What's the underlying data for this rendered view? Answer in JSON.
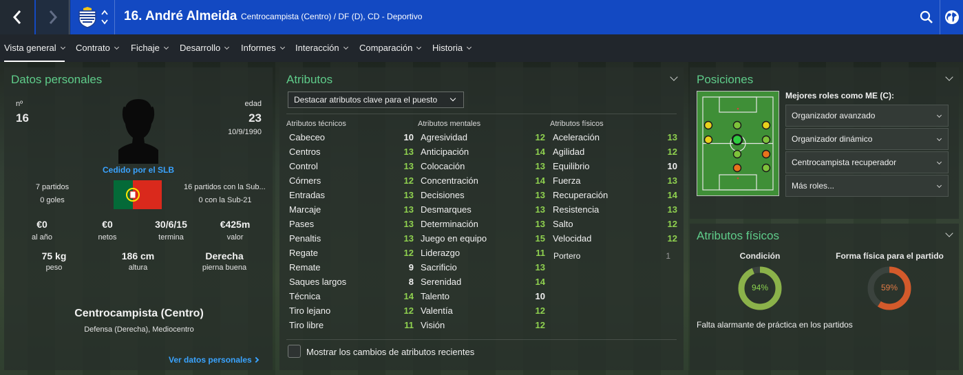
{
  "header": {
    "title": "16. André Almeida",
    "subtitle": "Centrocampista (Centro) / DF (D), CD - Deportivo",
    "back_icon": "chevron-left-icon",
    "forward_icon": "chevron-right-icon",
    "club_crest": "deportivo-crest-icon",
    "search_icon": "search-icon",
    "globe_icon": "globe-icon"
  },
  "menu": [
    {
      "label": "Vista general",
      "active": true
    },
    {
      "label": "Contrato"
    },
    {
      "label": "Fichaje"
    },
    {
      "label": "Desarrollo"
    },
    {
      "label": "Informes"
    },
    {
      "label": "Interacción"
    },
    {
      "label": "Comparación"
    },
    {
      "label": "Historia"
    }
  ],
  "personal": {
    "title": "Datos personales",
    "number_label": "nº",
    "number": "16",
    "age_label": "edad",
    "age": "23",
    "birthdate": "10/9/1990",
    "loan_text": "Cedido por el SLB",
    "apps": "7 partidos",
    "goals": "0 goles",
    "u21_apps": "16 partidos con la Sub...",
    "u21_goals": "0 con la Sub-21",
    "wage": "€0",
    "wage_label": "al año",
    "net": "€0",
    "net_label": "netos",
    "contract_end": "30/6/15",
    "contract_label": "termina",
    "value": "€425m",
    "value_label": "valor",
    "weight": "75 kg",
    "weight_label": "peso",
    "height": "186 cm",
    "height_label": "altura",
    "foot": "Derecha",
    "foot_label": "pierna buena",
    "position": "Centrocampista (Centro)",
    "position_sub": "Defensa (Derecha), Mediocentro",
    "link": "Ver datos personales",
    "flag": "portugal-flag-icon"
  },
  "attributes": {
    "title": "Atributos",
    "highlight_dropdown": "Destacar atributos clave para el puesto",
    "technical_header": "Atributos técnicos",
    "mental_header": "Atributos mentales",
    "physical_header": "Atributos físicos",
    "technical": [
      {
        "name": "Cabeceo",
        "value": "10"
      },
      {
        "name": "Centros",
        "value": "13"
      },
      {
        "name": "Control",
        "value": "13"
      },
      {
        "name": "Córners",
        "value": "12"
      },
      {
        "name": "Entradas",
        "value": "13"
      },
      {
        "name": "Marcaje",
        "value": "13"
      },
      {
        "name": "Pases",
        "value": "13"
      },
      {
        "name": "Penaltis",
        "value": "13"
      },
      {
        "name": "Regate",
        "value": "12"
      },
      {
        "name": "Remate",
        "value": "9"
      },
      {
        "name": "Saques largos",
        "value": "8"
      },
      {
        "name": "Técnica",
        "value": "14"
      },
      {
        "name": "Tiro lejano",
        "value": "12"
      },
      {
        "name": "Tiro libre",
        "value": "11"
      }
    ],
    "mental": [
      {
        "name": "Agresividad",
        "value": "12"
      },
      {
        "name": "Anticipación",
        "value": "14"
      },
      {
        "name": "Colocación",
        "value": "13"
      },
      {
        "name": "Concentración",
        "value": "14"
      },
      {
        "name": "Decisiones",
        "value": "13"
      },
      {
        "name": "Desmarques",
        "value": "13"
      },
      {
        "name": "Determinación",
        "value": "13"
      },
      {
        "name": "Juego en equipo",
        "value": "15"
      },
      {
        "name": "Liderazgo",
        "value": "11"
      },
      {
        "name": "Sacrificio",
        "value": "13"
      },
      {
        "name": "Serenidad",
        "value": "14"
      },
      {
        "name": "Talento",
        "value": "10"
      },
      {
        "name": "Valentía",
        "value": "12"
      },
      {
        "name": "Visión",
        "value": "12"
      }
    ],
    "physical": [
      {
        "name": "Aceleración",
        "value": "13"
      },
      {
        "name": "Agilidad",
        "value": "12"
      },
      {
        "name": "Equilibrio",
        "value": "10"
      },
      {
        "name": "Fuerza",
        "value": "13"
      },
      {
        "name": "Recuperación",
        "value": "14"
      },
      {
        "name": "Resistencia",
        "value": "13"
      },
      {
        "name": "Salto",
        "value": "12"
      },
      {
        "name": "Velocidad",
        "value": "12"
      }
    ],
    "goalkeeper": {
      "name": "Portero",
      "value": "1"
    },
    "show_changes": "Mostrar los cambios de atributos recientes"
  },
  "positions": {
    "title": "Posiciones",
    "roles_label": "Mejores roles como ME (C):",
    "roles": [
      "Organizador avanzado",
      "Organizador dinámico",
      "Centrocampista recuperador",
      "Más roles..."
    ],
    "colors": {
      "pitch": "#3f8f37",
      "natural": "#2ecc40",
      "accomplished": "#7ec23a",
      "unconvincing": "#e8d11c",
      "awkward": "#e8731c"
    }
  },
  "physical": {
    "title": "Atributos físicos",
    "condition_label": "Condición",
    "condition": 94,
    "condition_text": "94%",
    "fitness_label": "Forma física para el partido",
    "fitness": 59,
    "fitness_text": "59%",
    "warning": "Falta alarmante de práctica en los partidos",
    "colors": {
      "condition": "#8bb24a",
      "fitness": "#d35a2b",
      "track": "#3b433e"
    }
  }
}
